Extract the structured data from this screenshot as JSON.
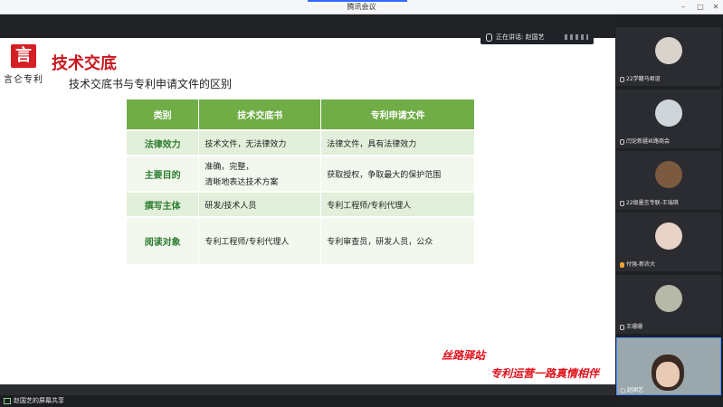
{
  "window": {
    "title": "腾讯会议",
    "controls": [
      "–",
      "□",
      "✕"
    ]
  },
  "speaking": {
    "label": "正在讲话: 赵国艺"
  },
  "slide": {
    "logo_char": "言",
    "logo_text": "言仑专利",
    "title": "技术交底",
    "subtitle": "技术交底书与专利申请文件的区别",
    "table": {
      "headers": [
        "类别",
        "技术交底书",
        "专利申请文件"
      ],
      "rows": [
        {
          "cat": "法律效力",
          "a": "技术文件，无法律效力",
          "b": "法律文件，具有法律效力"
        },
        {
          "cat": "主要目的",
          "a1": "准确，完整，",
          "a2": "清晰地表达技术方案",
          "b": "获取授权，争取最大的保护范围"
        },
        {
          "cat": "撰写主体",
          "a": "研发/技术人员",
          "b": "专利工程师/专利代理人"
        },
        {
          "cat": "阅读对象",
          "a": "专利工程师/专利代理人",
          "b": "专利审查员，研发人员，公众"
        }
      ]
    },
    "callig1": "丝路驿站",
    "callig2": "专利运营一路真情相伴"
  },
  "share": {
    "label": "赵国艺的屏幕共享"
  },
  "participants": [
    {
      "name": "22学籍马君谊"
    },
    {
      "name": "闫论新疆丝路商会"
    },
    {
      "name": "22级墨言专联-王瑞琪"
    },
    {
      "name": "付强-新农大"
    },
    {
      "name": "王珊珊"
    },
    {
      "name": "赵国艺"
    }
  ],
  "colors": {
    "accent_green": "#70ad47",
    "title_red": "#c8171e"
  }
}
